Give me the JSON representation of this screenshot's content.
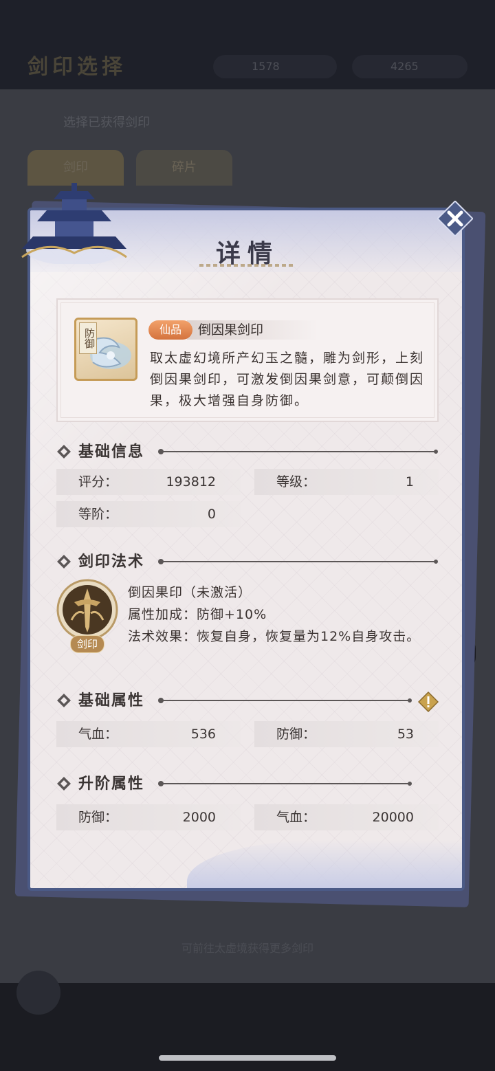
{
  "background": {
    "title": "剑印选择",
    "resource_1": "1578",
    "resource_2": "4265",
    "subtitle": "选择已获得剑印",
    "tabs": [
      "剑印",
      "碎片"
    ],
    "bottom_note": "可前往太虚境获得更多剑印"
  },
  "dialog": {
    "title": "详情",
    "close_icon": "close-icon"
  },
  "item": {
    "icon_tag": "防御",
    "rarity": "仙品",
    "name": "倒因果剑印",
    "description": "取太虚幻境所产幻玉之髓，雕为剑形，上刻倒因果剑印，可激发倒因果剑意，可颠倒因果，极大增强自身防御。",
    "rarity_color": "#e08a52"
  },
  "basic_info": {
    "title": "基础信息",
    "rows": [
      {
        "label": "评分：",
        "value": "193812"
      },
      {
        "label": "等级：",
        "value": "1"
      },
      {
        "label": "等阶：",
        "value": "0"
      }
    ]
  },
  "skill": {
    "title": "剑印法术",
    "icon_tag": "剑印",
    "name": "倒因果印（未激活）",
    "bonus": "属性加成：防御+10%",
    "effect": "法术效果：恢复自身，恢复量为12%自身攻击。"
  },
  "base_attributes": {
    "title": "基础属性",
    "rows": [
      {
        "label": "气血：",
        "value": "536"
      },
      {
        "label": "防御：",
        "value": "53"
      }
    ]
  },
  "upgrade_attributes": {
    "title": "升阶属性",
    "rows": [
      {
        "label": "防御：",
        "value": "2000"
      },
      {
        "label": "气血：",
        "value": "20000"
      }
    ]
  }
}
